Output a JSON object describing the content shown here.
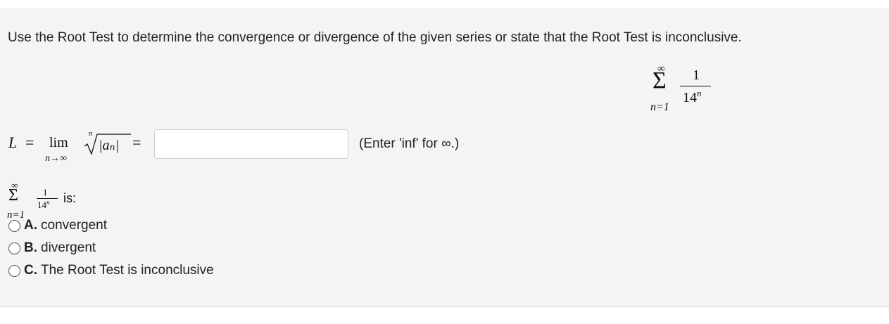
{
  "question": {
    "text": "Use the Root Test to determine the convergence or divergence of the given series or state that the Root Test is inconclusive."
  },
  "series": {
    "sum_symbol": "Σ",
    "upper": "∞",
    "lower": "n=1",
    "numerator": "1",
    "denominator_base": "14",
    "denominator_exp": "n"
  },
  "limit_row": {
    "L": "L",
    "equals": "=",
    "lim": "lim",
    "lim_sub": "n→∞",
    "root_index": "n",
    "radicand": "|aₙ|",
    "equals2": "=",
    "input_value": "",
    "hint": "(Enter 'inf' for ∞.)"
  },
  "choice_prompt": {
    "is_label": "is:"
  },
  "options": [
    {
      "letter": "A.",
      "label": "convergent"
    },
    {
      "letter": "B.",
      "label": "divergent"
    },
    {
      "letter": "C.",
      "label": "The Root Test is inconclusive"
    }
  ],
  "colors": {
    "panel": "#f4f4f4",
    "text": "#222222",
    "input_border": "#cfcfcf"
  }
}
